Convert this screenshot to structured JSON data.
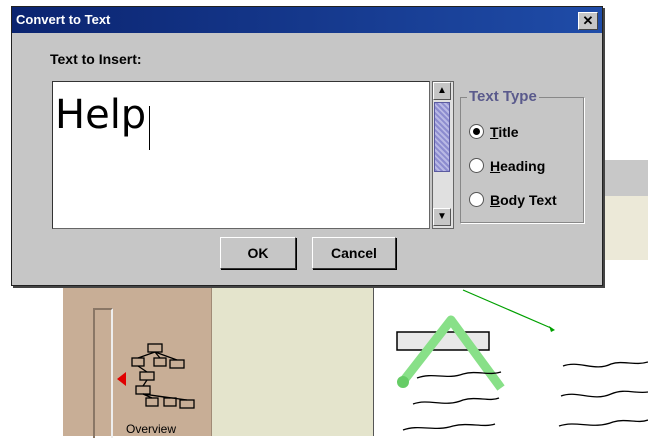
{
  "dialog": {
    "title": "Convert to Text",
    "close_glyph": "✕",
    "text_label": "Text to Insert:",
    "text_value": "Help",
    "text_type": {
      "legend": "Text Type",
      "options": [
        {
          "label": "Title",
          "mnemonic": "T",
          "rest": "itle",
          "selected": true
        },
        {
          "label": "Heading",
          "mnemonic": "H",
          "rest": "eading",
          "selected": false
        },
        {
          "label": "Body Text",
          "mnemonic": "B",
          "rest": "ody Text",
          "selected": false
        }
      ]
    },
    "ok_label": "OK",
    "cancel_label": "Cancel",
    "scroll_up_glyph": "▲",
    "scroll_down_glyph": "▼"
  },
  "background": {
    "overview_label": "Overview",
    "icons": [
      "sitemap-icon",
      "red-pointer-icon"
    ],
    "colors": {
      "panel": "#c8ae96",
      "middle_panel": "#e4e4cc",
      "stroke_green": "#66cc66"
    }
  }
}
